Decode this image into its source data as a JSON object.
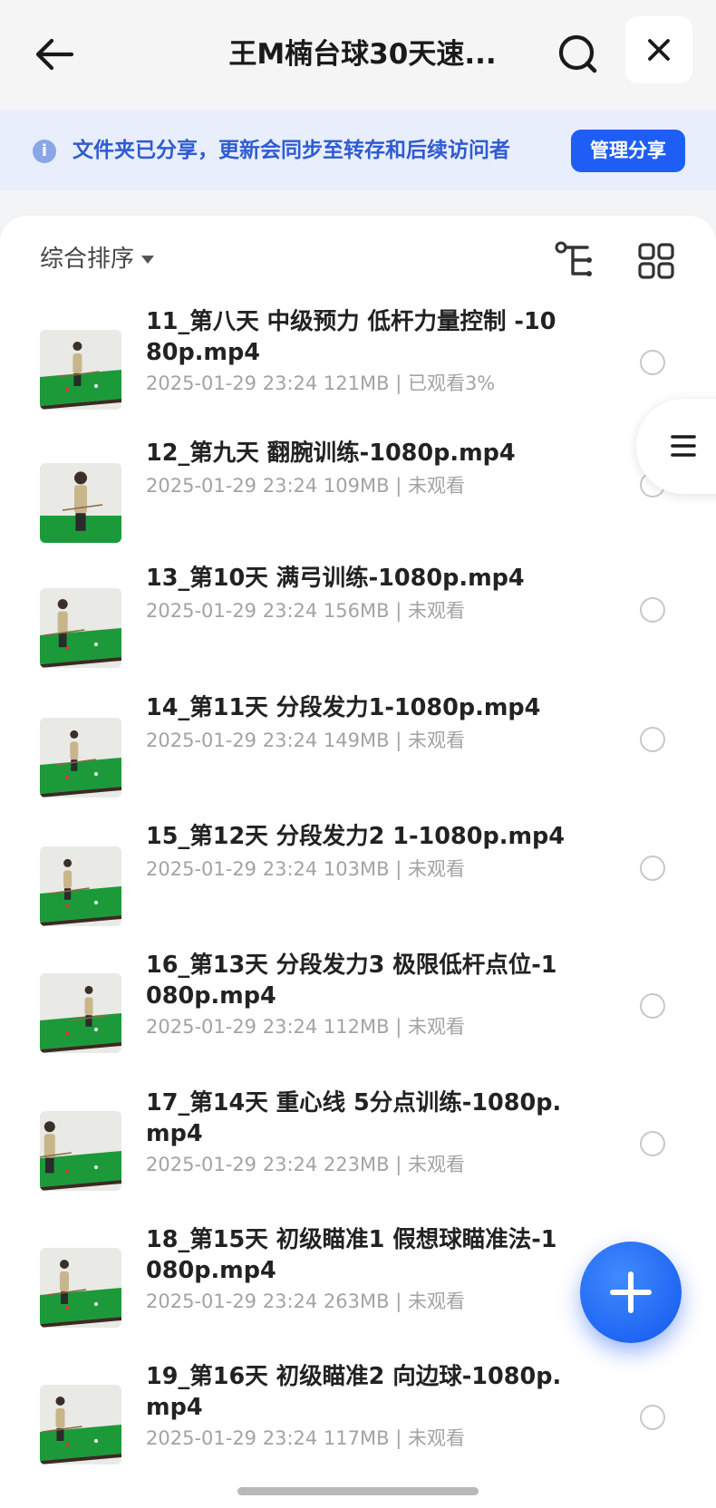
{
  "header": {
    "title": "王M楠台球30天速...",
    "back_icon": "arrow-left-icon",
    "search_icon": "search-icon",
    "close_icon": "close-icon"
  },
  "banner": {
    "info_icon": "info-icon",
    "info_glyph": "i",
    "text": "文件夹已分享，更新会同步至转存和后续访问者",
    "manage_button": "管理分享"
  },
  "toolbar": {
    "sort_label": "综合排序",
    "tree_icon": "tree-view-icon",
    "grid_icon": "grid-view-icon"
  },
  "files": [
    {
      "name": "11_第八天 中级预力 低杆力量控制 -1080p.mp4",
      "meta": "2025-01-29 23:24  121MB | 已观看3%"
    },
    {
      "name": "12_第九天 翻腕训练-1080p.mp4",
      "meta": "2025-01-29 23:24  109MB | 未观看"
    },
    {
      "name": "13_第10天 满弓训练-1080p.mp4",
      "meta": "2025-01-29 23:24  156MB | 未观看"
    },
    {
      "name": "14_第11天 分段发力1-1080p.mp4",
      "meta": "2025-01-29 23:24  149MB | 未观看"
    },
    {
      "name": "15_第12天 分段发力2 1-1080p.mp4",
      "meta": "2025-01-29 23:24  103MB | 未观看"
    },
    {
      "name": "16_第13天 分段发力3 极限低杆点位-1080p.mp4",
      "meta": "2025-01-29 23:24  112MB | 未观看"
    },
    {
      "name": "17_第14天 重心线  5分点训练-1080p.mp4",
      "meta": "2025-01-29 23:24  223MB | 未观看"
    },
    {
      "name": "18_第15天 初级瞄准1  假想球瞄准法-1080p.mp4",
      "meta": "2025-01-29 23:24  263MB | 未观看"
    },
    {
      "name": "19_第16天 初级瞄准2 向边球-1080p.mp4",
      "meta": "2025-01-29 23:24  117MB | 未观看"
    }
  ],
  "side_tab_icon": "menu-icon",
  "fab_icon": "plus-icon",
  "colors": {
    "accent": "#1f5ef5",
    "banner_bg": "#e8eefb",
    "banner_text": "#2f5bd3",
    "table_green": "#1c9a3a"
  }
}
